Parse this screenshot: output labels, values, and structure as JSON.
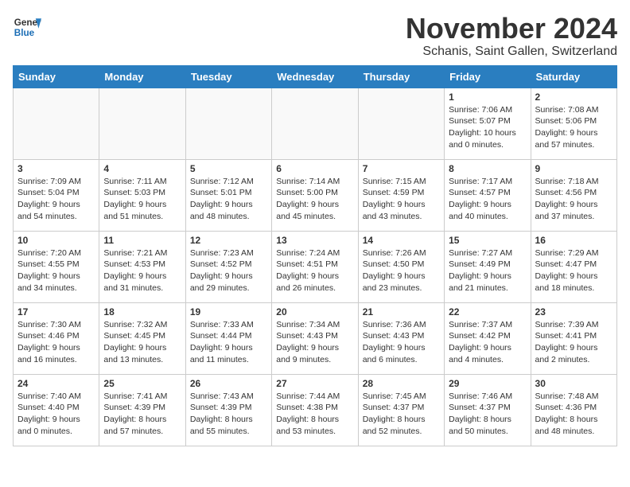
{
  "header": {
    "logo_line1": "General",
    "logo_line2": "Blue",
    "month": "November 2024",
    "location": "Schanis, Saint Gallen, Switzerland"
  },
  "weekdays": [
    "Sunday",
    "Monday",
    "Tuesday",
    "Wednesday",
    "Thursday",
    "Friday",
    "Saturday"
  ],
  "weeks": [
    [
      {
        "day": "",
        "info": "",
        "empty": true
      },
      {
        "day": "",
        "info": "",
        "empty": true
      },
      {
        "day": "",
        "info": "",
        "empty": true
      },
      {
        "day": "",
        "info": "",
        "empty": true
      },
      {
        "day": "",
        "info": "",
        "empty": true
      },
      {
        "day": "1",
        "info": "Sunrise: 7:06 AM\nSunset: 5:07 PM\nDaylight: 10 hours and 0 minutes.",
        "empty": false
      },
      {
        "day": "2",
        "info": "Sunrise: 7:08 AM\nSunset: 5:06 PM\nDaylight: 9 hours and 57 minutes.",
        "empty": false
      }
    ],
    [
      {
        "day": "3",
        "info": "Sunrise: 7:09 AM\nSunset: 5:04 PM\nDaylight: 9 hours and 54 minutes.",
        "empty": false
      },
      {
        "day": "4",
        "info": "Sunrise: 7:11 AM\nSunset: 5:03 PM\nDaylight: 9 hours and 51 minutes.",
        "empty": false
      },
      {
        "day": "5",
        "info": "Sunrise: 7:12 AM\nSunset: 5:01 PM\nDaylight: 9 hours and 48 minutes.",
        "empty": false
      },
      {
        "day": "6",
        "info": "Sunrise: 7:14 AM\nSunset: 5:00 PM\nDaylight: 9 hours and 45 minutes.",
        "empty": false
      },
      {
        "day": "7",
        "info": "Sunrise: 7:15 AM\nSunset: 4:59 PM\nDaylight: 9 hours and 43 minutes.",
        "empty": false
      },
      {
        "day": "8",
        "info": "Sunrise: 7:17 AM\nSunset: 4:57 PM\nDaylight: 9 hours and 40 minutes.",
        "empty": false
      },
      {
        "day": "9",
        "info": "Sunrise: 7:18 AM\nSunset: 4:56 PM\nDaylight: 9 hours and 37 minutes.",
        "empty": false
      }
    ],
    [
      {
        "day": "10",
        "info": "Sunrise: 7:20 AM\nSunset: 4:55 PM\nDaylight: 9 hours and 34 minutes.",
        "empty": false
      },
      {
        "day": "11",
        "info": "Sunrise: 7:21 AM\nSunset: 4:53 PM\nDaylight: 9 hours and 31 minutes.",
        "empty": false
      },
      {
        "day": "12",
        "info": "Sunrise: 7:23 AM\nSunset: 4:52 PM\nDaylight: 9 hours and 29 minutes.",
        "empty": false
      },
      {
        "day": "13",
        "info": "Sunrise: 7:24 AM\nSunset: 4:51 PM\nDaylight: 9 hours and 26 minutes.",
        "empty": false
      },
      {
        "day": "14",
        "info": "Sunrise: 7:26 AM\nSunset: 4:50 PM\nDaylight: 9 hours and 23 minutes.",
        "empty": false
      },
      {
        "day": "15",
        "info": "Sunrise: 7:27 AM\nSunset: 4:49 PM\nDaylight: 9 hours and 21 minutes.",
        "empty": false
      },
      {
        "day": "16",
        "info": "Sunrise: 7:29 AM\nSunset: 4:47 PM\nDaylight: 9 hours and 18 minutes.",
        "empty": false
      }
    ],
    [
      {
        "day": "17",
        "info": "Sunrise: 7:30 AM\nSunset: 4:46 PM\nDaylight: 9 hours and 16 minutes.",
        "empty": false
      },
      {
        "day": "18",
        "info": "Sunrise: 7:32 AM\nSunset: 4:45 PM\nDaylight: 9 hours and 13 minutes.",
        "empty": false
      },
      {
        "day": "19",
        "info": "Sunrise: 7:33 AM\nSunset: 4:44 PM\nDaylight: 9 hours and 11 minutes.",
        "empty": false
      },
      {
        "day": "20",
        "info": "Sunrise: 7:34 AM\nSunset: 4:43 PM\nDaylight: 9 hours and 9 minutes.",
        "empty": false
      },
      {
        "day": "21",
        "info": "Sunrise: 7:36 AM\nSunset: 4:43 PM\nDaylight: 9 hours and 6 minutes.",
        "empty": false
      },
      {
        "day": "22",
        "info": "Sunrise: 7:37 AM\nSunset: 4:42 PM\nDaylight: 9 hours and 4 minutes.",
        "empty": false
      },
      {
        "day": "23",
        "info": "Sunrise: 7:39 AM\nSunset: 4:41 PM\nDaylight: 9 hours and 2 minutes.",
        "empty": false
      }
    ],
    [
      {
        "day": "24",
        "info": "Sunrise: 7:40 AM\nSunset: 4:40 PM\nDaylight: 9 hours and 0 minutes.",
        "empty": false
      },
      {
        "day": "25",
        "info": "Sunrise: 7:41 AM\nSunset: 4:39 PM\nDaylight: 8 hours and 57 minutes.",
        "empty": false
      },
      {
        "day": "26",
        "info": "Sunrise: 7:43 AM\nSunset: 4:39 PM\nDaylight: 8 hours and 55 minutes.",
        "empty": false
      },
      {
        "day": "27",
        "info": "Sunrise: 7:44 AM\nSunset: 4:38 PM\nDaylight: 8 hours and 53 minutes.",
        "empty": false
      },
      {
        "day": "28",
        "info": "Sunrise: 7:45 AM\nSunset: 4:37 PM\nDaylight: 8 hours and 52 minutes.",
        "empty": false
      },
      {
        "day": "29",
        "info": "Sunrise: 7:46 AM\nSunset: 4:37 PM\nDaylight: 8 hours and 50 minutes.",
        "empty": false
      },
      {
        "day": "30",
        "info": "Sunrise: 7:48 AM\nSunset: 4:36 PM\nDaylight: 8 hours and 48 minutes.",
        "empty": false
      }
    ]
  ]
}
